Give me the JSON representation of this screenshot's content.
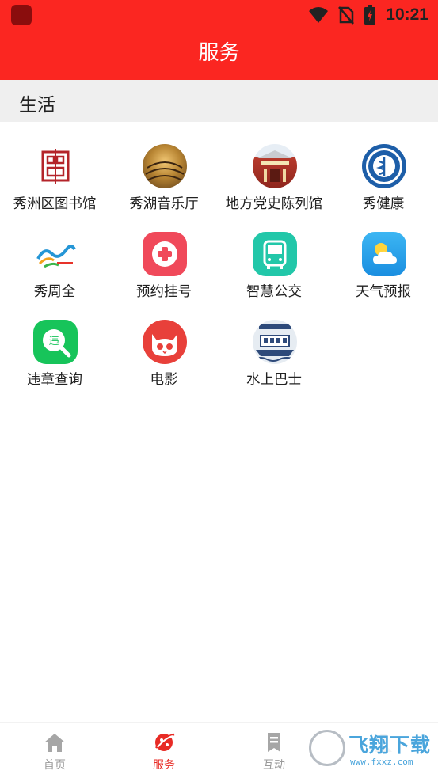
{
  "status_bar": {
    "time": "10:21"
  },
  "header": {
    "title": "服务"
  },
  "section": {
    "title": "生活"
  },
  "services": [
    {
      "label": "秀洲区图书馆",
      "icon": "library-logo-icon"
    },
    {
      "label": "秀湖音乐厅",
      "icon": "concert-hall-photo-icon"
    },
    {
      "label": "地方党史陈列馆",
      "icon": "history-museum-photo-icon"
    },
    {
      "label": "秀健康",
      "icon": "health-emblem-icon"
    },
    {
      "label": "秀周全",
      "icon": "xiuzhouquan-logo-icon"
    },
    {
      "label": "预约挂号",
      "icon": "medical-cross-icon"
    },
    {
      "label": "智慧公交",
      "icon": "bus-icon"
    },
    {
      "label": "天气预报",
      "icon": "weather-icon"
    },
    {
      "label": "违章查询",
      "icon": "violation-search-icon"
    },
    {
      "label": "电影",
      "icon": "cat-face-icon"
    },
    {
      "label": "水上巴士",
      "icon": "water-bus-photo-icon"
    }
  ],
  "tabs": [
    {
      "label": "首页",
      "icon": "home-icon",
      "active": false
    },
    {
      "label": "服务",
      "icon": "service-icon",
      "active": true
    },
    {
      "label": "互动",
      "icon": "bookmark-icon",
      "active": false
    },
    {
      "label": "",
      "icon": "profile-icon",
      "active": false
    }
  ],
  "watermark": {
    "main": "飞翔下载",
    "sub": "www.fxxz.com"
  },
  "colors": {
    "accent": "#fb2621",
    "tab_active": "#e82b25",
    "tab_inactive": "#9a9a9a"
  }
}
